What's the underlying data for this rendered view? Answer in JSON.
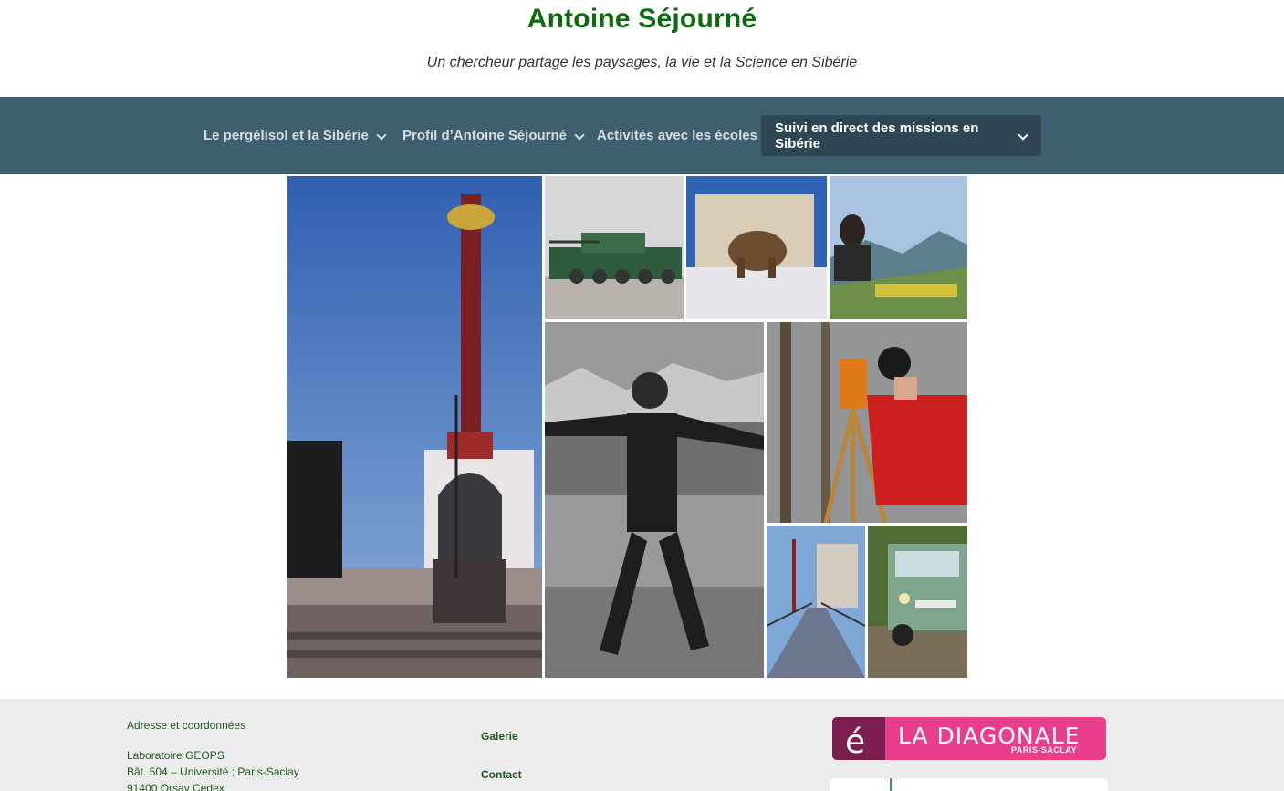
{
  "site": {
    "title": "Antoine Séjourné",
    "tagline": "Un chercheur partage les paysages, la vie et la Science en Sibérie"
  },
  "nav": {
    "items": [
      {
        "label": "Le pergélisol et la Sibérie",
        "has_dropdown": true,
        "active": false
      },
      {
        "label": "Profil d’Antoine Séjourné",
        "has_dropdown": true,
        "active": false
      },
      {
        "label": "Activités avec les écoles",
        "has_dropdown": false,
        "active": false
      },
      {
        "label": "Suivi en direct des missions en Sibérie",
        "has_dropdown": true,
        "active": true
      }
    ]
  },
  "gallery": {
    "photos": [
      {
        "name": "photo-monument-column"
      },
      {
        "name": "photo-tank"
      },
      {
        "name": "photo-mammoth-statue"
      },
      {
        "name": "photo-mountain-laptop"
      },
      {
        "name": "photo-portrait-mountains"
      },
      {
        "name": "photo-surveyor-theodolite"
      },
      {
        "name": "photo-footbridge"
      },
      {
        "name": "photo-green-van"
      }
    ]
  },
  "footer": {
    "address_heading": "Adresse et coordonnées",
    "address_lines": [
      "Laboratoire GEOPS",
      "Bât. 504 – Université ; Paris-Saclay",
      "91400 Orsay Cedex"
    ],
    "links": [
      "Galerie",
      "Contact"
    ],
    "logo": {
      "main": "LA DIAGONALE",
      "sub": "PARIS-SACLAY",
      "mark": "é"
    }
  },
  "colors": {
    "title_green": "#0d6a0d",
    "nav_bg": "#3e5f6f",
    "nav_active_bg": "#2f4655",
    "footer_bg": "#ececec",
    "logo_pink": "#e83e8c"
  }
}
